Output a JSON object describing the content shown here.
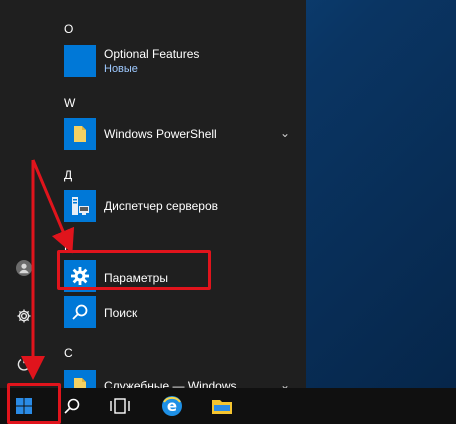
{
  "start_menu": {
    "sections": [
      {
        "letter": "O"
      },
      {
        "letter": "W"
      },
      {
        "letter": "Д"
      },
      {
        "letter": "П"
      },
      {
        "letter": "С"
      }
    ],
    "items": [
      {
        "label": "Optional Features",
        "sub": "Новые"
      },
      {
        "label": "Windows PowerShell",
        "expand": "⌄"
      },
      {
        "label": "Диспетчер серверов"
      },
      {
        "label": "Параметры"
      },
      {
        "label": "Поиск"
      },
      {
        "label": "Служебные — Windows",
        "expand": "⌄"
      }
    ]
  },
  "colors": {
    "accent": "#0078d7",
    "highlight": "#e0141c",
    "menu_bg": "#1f1f1f",
    "taskbar_bg": "#101010"
  },
  "rail_icons": [
    "user-icon",
    "settings-icon",
    "power-icon"
  ],
  "taskbar_icons": [
    "start-icon",
    "search-icon",
    "task-view-icon",
    "edge-icon",
    "file-explorer-icon"
  ]
}
